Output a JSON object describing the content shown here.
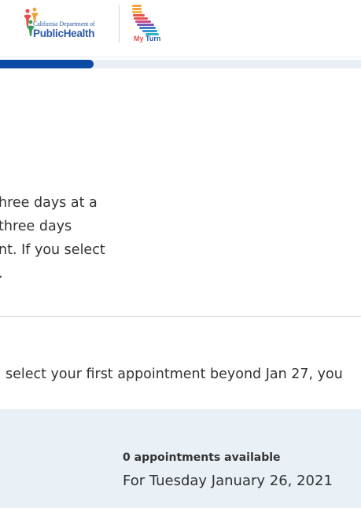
{
  "header": {
    "cdph_logo_small": "California Department of",
    "cdph_logo_big": "PublicHealth",
    "myturn_logo_my": "My",
    "myturn_logo_turn": "Turn"
  },
  "progress": {
    "fraction": 0.26
  },
  "body": {
    "lines": [
      "hree days at a",
      " three days",
      "nt. If you select",
      "."
    ],
    "notice": " select your first appointment beyond Jan 27, you"
  },
  "availability": {
    "count_text": "0 appointments available",
    "date_text": "For Tuesday January 26, 2021"
  },
  "colors": {
    "primary_blue": "#0b4ba7",
    "panel_bg": "#eaf1f6",
    "text": "#333333"
  }
}
